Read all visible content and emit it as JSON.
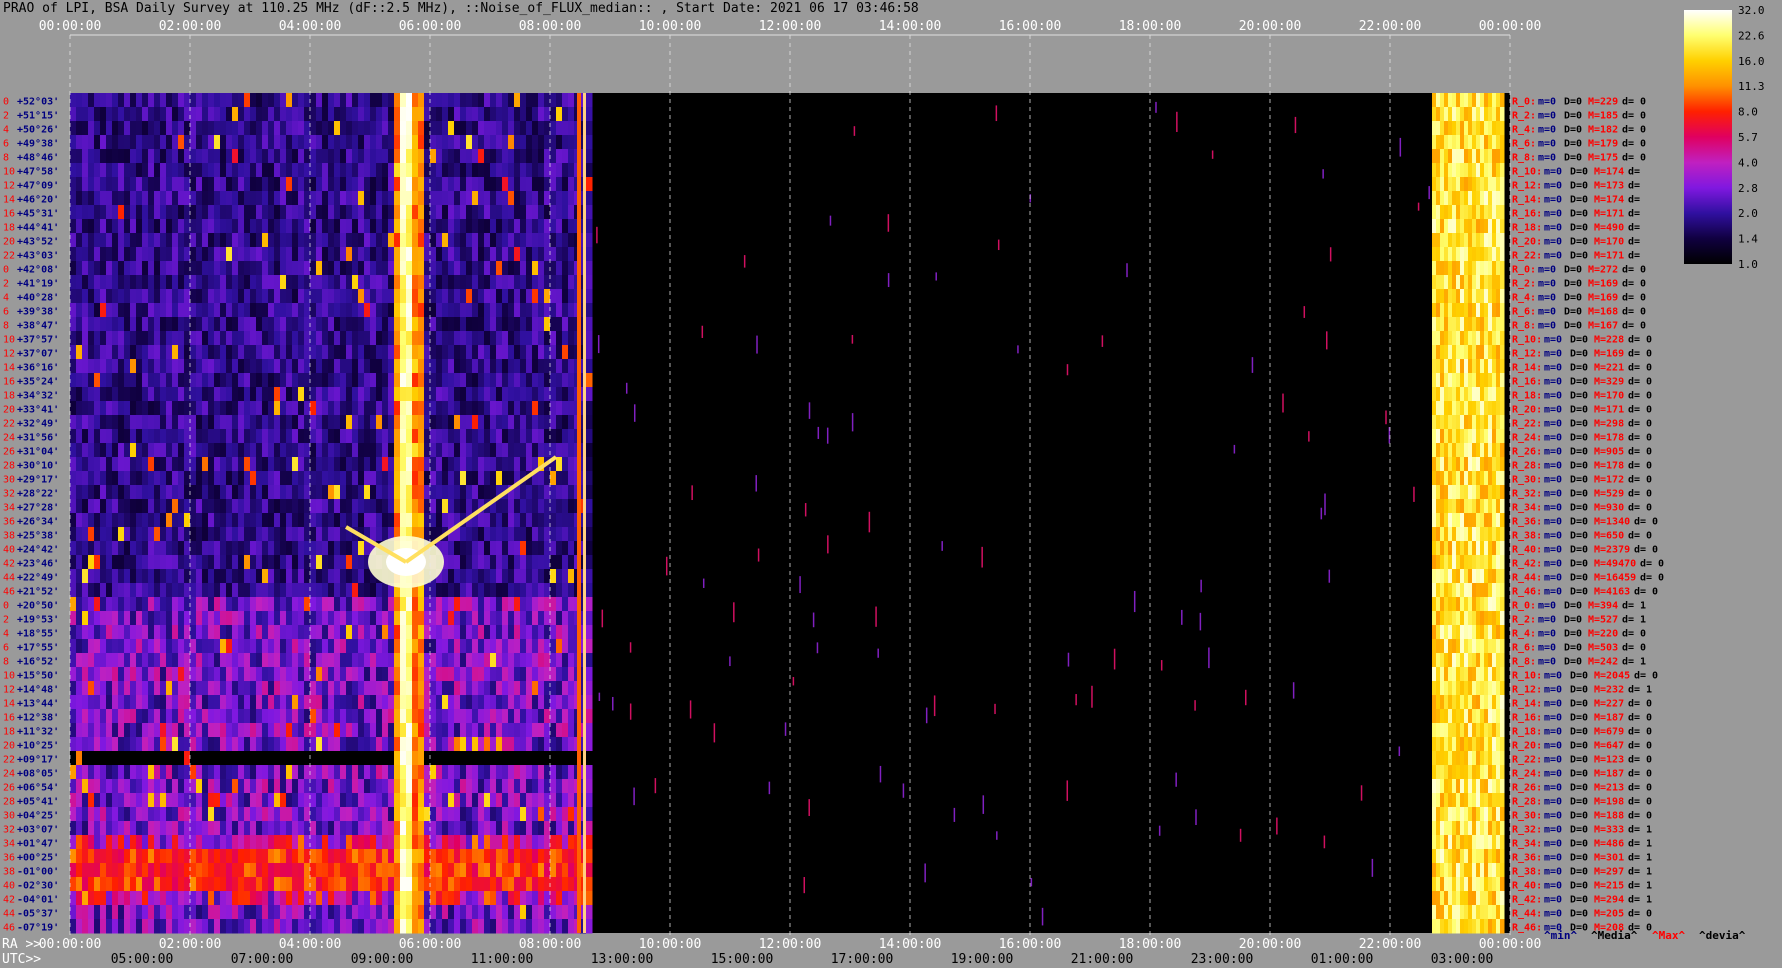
{
  "title": "PRAO of LPI, BSA Daily Survey at 110.25 MHz (dF::2.5 MHz), ::Noise_of_FLUX_median:: , Start Date: 2021 06 17 03:46:58",
  "chart_data": {
    "type": "heatmap",
    "top_ticks": [
      "00:00:00",
      "02:00:00",
      "04:00:00",
      "06:00:00",
      "08:00:00",
      "10:00:00",
      "12:00:00",
      "14:00:00",
      "16:00:00",
      "18:00:00",
      "20:00:00",
      "22:00:00",
      "00:00:00"
    ],
    "ra_prefix": "RA >>",
    "ra_ticks": [
      "00:00:00",
      "02:00:00",
      "04:00:00",
      "06:00:00",
      "08:00:00",
      "10:00:00",
      "12:00:00",
      "14:00:00",
      "16:00:00",
      "18:00:00",
      "20:00:00",
      "22:00:00",
      "00:00:00"
    ],
    "utc_prefix": "UTC>>",
    "utc_ticks": [
      "05:00:00",
      "07:00:00",
      "09:00:00",
      "11:00:00",
      "13:00:00",
      "15:00:00",
      "17:00:00",
      "19:00:00",
      "21:00:00",
      "23:00:00",
      "01:00:00",
      "03:00:00"
    ],
    "rows": [
      {
        "beam": "0",
        "dec": "+52°03'",
        "label": "R_0:",
        "min": "m=0",
        "med": "D=0",
        "max": "M=229",
        "dev": "d= 0"
      },
      {
        "beam": "2",
        "dec": "+51°15'",
        "label": "R_2:",
        "min": "m=0",
        "med": "D=0",
        "max": "M=185",
        "dev": "d= 0"
      },
      {
        "beam": "4",
        "dec": "+50°26'",
        "label": "R_4:",
        "min": "m=0",
        "med": "D=0",
        "max": "M=182",
        "dev": "d= 0"
      },
      {
        "beam": "6",
        "dec": "+49°38'",
        "label": "R_6:",
        "min": "m=0",
        "med": "D=0",
        "max": "M=179",
        "dev": "d= 0"
      },
      {
        "beam": "8",
        "dec": "+48°46'",
        "label": "R_8:",
        "min": "m=0",
        "med": "D=0",
        "max": "M=175",
        "dev": "d= 0"
      },
      {
        "beam": "10",
        "dec": "+47°58'",
        "label": "R_10:",
        "min": "m=0",
        "med": "D=0",
        "max": "M=174",
        "dev": "d="
      },
      {
        "beam": "12",
        "dec": "+47°09'",
        "label": "R_12:",
        "min": "m=0",
        "med": "D=0",
        "max": "M=173",
        "dev": "d="
      },
      {
        "beam": "14",
        "dec": "+46°20'",
        "label": "R_14:",
        "min": "m=0",
        "med": "D=0",
        "max": "M=174",
        "dev": "d="
      },
      {
        "beam": "16",
        "dec": "+45°31'",
        "label": "R_16:",
        "min": "m=0",
        "med": "D=0",
        "max": "M=171",
        "dev": "d="
      },
      {
        "beam": "18",
        "dec": "+44°41'",
        "label": "R_18:",
        "min": "m=0",
        "med": "D=0",
        "max": "M=490",
        "dev": "d="
      },
      {
        "beam": "20",
        "dec": "+43°52'",
        "label": "R_20:",
        "min": "m=0",
        "med": "D=0",
        "max": "M=170",
        "dev": "d="
      },
      {
        "beam": "22",
        "dec": "+43°03'",
        "label": "R_22:",
        "min": "m=0",
        "med": "D=0",
        "max": "M=171",
        "dev": "d="
      },
      {
        "beam": "0",
        "dec": "+42°08'",
        "label": "R_0:",
        "min": "m=0",
        "med": "D=0",
        "max": "M=272",
        "dev": "d= 0"
      },
      {
        "beam": "2",
        "dec": "+41°19'",
        "label": "R_2:",
        "min": "m=0",
        "med": "D=0",
        "max": "M=169",
        "dev": "d= 0"
      },
      {
        "beam": "4",
        "dec": "+40°28'",
        "label": "R_4:",
        "min": "m=0",
        "med": "D=0",
        "max": "M=169",
        "dev": "d= 0"
      },
      {
        "beam": "6",
        "dec": "+39°38'",
        "label": "R_6:",
        "min": "m=0",
        "med": "D=0",
        "max": "M=168",
        "dev": "d= 0"
      },
      {
        "beam": "8",
        "dec": "+38°47'",
        "label": "R_8:",
        "min": "m=0",
        "med": "D=0",
        "max": "M=167",
        "dev": "d= 0"
      },
      {
        "beam": "10",
        "dec": "+37°57'",
        "label": "R_10:",
        "min": "m=0",
        "med": "D=0",
        "max": "M=228",
        "dev": "d= 0"
      },
      {
        "beam": "12",
        "dec": "+37°07'",
        "label": "R_12:",
        "min": "m=0",
        "med": "D=0",
        "max": "M=169",
        "dev": "d= 0"
      },
      {
        "beam": "14",
        "dec": "+36°16'",
        "label": "R_14:",
        "min": "m=0",
        "med": "D=0",
        "max": "M=221",
        "dev": "d= 0"
      },
      {
        "beam": "16",
        "dec": "+35°24'",
        "label": "R_16:",
        "min": "m=0",
        "med": "D=0",
        "max": "M=329",
        "dev": "d= 0"
      },
      {
        "beam": "18",
        "dec": "+34°32'",
        "label": "R_18:",
        "min": "m=0",
        "med": "D=0",
        "max": "M=170",
        "dev": "d= 0"
      },
      {
        "beam": "20",
        "dec": "+33°41'",
        "label": "R_20:",
        "min": "m=0",
        "med": "D=0",
        "max": "M=171",
        "dev": "d= 0"
      },
      {
        "beam": "22",
        "dec": "+32°49'",
        "label": "R_22:",
        "min": "m=0",
        "med": "D=0",
        "max": "M=298",
        "dev": "d= 0"
      },
      {
        "beam": "24",
        "dec": "+31°56'",
        "label": "R_24:",
        "min": "m=0",
        "med": "D=0",
        "max": "M=178",
        "dev": "d= 0"
      },
      {
        "beam": "26",
        "dec": "+31°04'",
        "label": "R_26:",
        "min": "m=0",
        "med": "D=0",
        "max": "M=905",
        "dev": "d= 0"
      },
      {
        "beam": "28",
        "dec": "+30°10'",
        "label": "R_28:",
        "min": "m=0",
        "med": "D=0",
        "max": "M=178",
        "dev": "d= 0"
      },
      {
        "beam": "30",
        "dec": "+29°17'",
        "label": "R_30:",
        "min": "m=0",
        "med": "D=0",
        "max": "M=172",
        "dev": "d= 0"
      },
      {
        "beam": "32",
        "dec": "+28°22'",
        "label": "R_32:",
        "min": "m=0",
        "med": "D=0",
        "max": "M=529",
        "dev": "d= 0"
      },
      {
        "beam": "34",
        "dec": "+27°28'",
        "label": "R_34:",
        "min": "m=0",
        "med": "D=0",
        "max": "M=930",
        "dev": "d= 0"
      },
      {
        "beam": "36",
        "dec": "+26°34'",
        "label": "R_36:",
        "min": "m=0",
        "med": "D=0",
        "max": "M=1340",
        "dev": "d= 0"
      },
      {
        "beam": "38",
        "dec": "+25°38'",
        "label": "R_38:",
        "min": "m=0",
        "med": "D=0",
        "max": "M=650",
        "dev": "d= 0"
      },
      {
        "beam": "40",
        "dec": "+24°42'",
        "label": "R_40:",
        "min": "m=0",
        "med": "D=0",
        "max": "M=2379",
        "dev": "d= 0"
      },
      {
        "beam": "42",
        "dec": "+23°46'",
        "label": "R_42:",
        "min": "m=0",
        "med": "D=0",
        "max": "M=49470",
        "dev": "d= 0"
      },
      {
        "beam": "44",
        "dec": "+22°49'",
        "label": "R_44:",
        "min": "m=0",
        "med": "D=0",
        "max": "M=16459",
        "dev": "d= 0"
      },
      {
        "beam": "46",
        "dec": "+21°52'",
        "label": "R_46:",
        "min": "m=0",
        "med": "D=0",
        "max": "M=4163",
        "dev": "d= 0"
      },
      {
        "beam": "0",
        "dec": "+20°50'",
        "label": "R_0:",
        "min": "m=0",
        "med": "D=0",
        "max": "M=394",
        "dev": "d= 1"
      },
      {
        "beam": "2",
        "dec": "+19°53'",
        "label": "R_2:",
        "min": "m=0",
        "med": "D=0",
        "max": "M=527",
        "dev": "d= 1"
      },
      {
        "beam": "4",
        "dec": "+18°55'",
        "label": "R_4:",
        "min": "m=0",
        "med": "D=0",
        "max": "M=220",
        "dev": "d= 0"
      },
      {
        "beam": "6",
        "dec": "+17°55'",
        "label": "R_6:",
        "min": "m=0",
        "med": "D=0",
        "max": "M=503",
        "dev": "d= 0"
      },
      {
        "beam": "8",
        "dec": "+16°52'",
        "label": "R_8:",
        "min": "m=0",
        "med": "D=0",
        "max": "M=242",
        "dev": "d= 1"
      },
      {
        "beam": "10",
        "dec": "+15°50'",
        "label": "R_10:",
        "min": "m=0",
        "med": "D=0",
        "max": "M=2045",
        "dev": "d= 0"
      },
      {
        "beam": "12",
        "dec": "+14°48'",
        "label": "R_12:",
        "min": "m=0",
        "med": "D=0",
        "max": "M=232",
        "dev": "d= 1"
      },
      {
        "beam": "14",
        "dec": "+13°44'",
        "label": "R_14:",
        "min": "m=0",
        "med": "D=0",
        "max": "M=227",
        "dev": "d= 0"
      },
      {
        "beam": "16",
        "dec": "+12°38'",
        "label": "R_16:",
        "min": "m=0",
        "med": "D=0",
        "max": "M=187",
        "dev": "d= 0"
      },
      {
        "beam": "18",
        "dec": "+11°32'",
        "label": "R_18:",
        "min": "m=0",
        "med": "D=0",
        "max": "M=679",
        "dev": "d= 0"
      },
      {
        "beam": "20",
        "dec": "+10°25'",
        "label": "R_20:",
        "min": "m=0",
        "med": "D=0",
        "max": "M=647",
        "dev": "d= 0"
      },
      {
        "beam": "22",
        "dec": "+09°17'",
        "label": "R_22:",
        "min": "m=0",
        "med": "D=0",
        "max": "M=123",
        "dev": "d= 0"
      },
      {
        "beam": "24",
        "dec": "+08°05'",
        "label": "R_24:",
        "min": "m=0",
        "med": "D=0",
        "max": "M=187",
        "dev": "d= 0"
      },
      {
        "beam": "26",
        "dec": "+06°54'",
        "label": "R_26:",
        "min": "m=0",
        "med": "D=0",
        "max": "M=213",
        "dev": "d= 0"
      },
      {
        "beam": "28",
        "dec": "+05°41'",
        "label": "R_28:",
        "min": "m=0",
        "med": "D=0",
        "max": "M=198",
        "dev": "d= 0"
      },
      {
        "beam": "30",
        "dec": "+04°25'",
        "label": "R_30:",
        "min": "m=0",
        "med": "D=0",
        "max": "M=188",
        "dev": "d= 0"
      },
      {
        "beam": "32",
        "dec": "+03°07'",
        "label": "R_32:",
        "min": "m=0",
        "med": "D=0",
        "max": "M=333",
        "dev": "d= 1"
      },
      {
        "beam": "34",
        "dec": "+01°47'",
        "label": "R_34:",
        "min": "m=0",
        "med": "D=0",
        "max": "M=486",
        "dev": "d= 1"
      },
      {
        "beam": "36",
        "dec": "+00°25'",
        "label": "R_36:",
        "min": "m=0",
        "med": "D=0",
        "max": "M=301",
        "dev": "d= 1"
      },
      {
        "beam": "38",
        "dec": "-01°00'",
        "label": "R_38:",
        "min": "m=0",
        "med": "D=0",
        "max": "M=297",
        "dev": "d= 1"
      },
      {
        "beam": "40",
        "dec": "-02°30'",
        "label": "R_40:",
        "min": "m=0",
        "med": "D=0",
        "max": "M=215",
        "dev": "d= 1"
      },
      {
        "beam": "42",
        "dec": "-04°01'",
        "label": "R_42:",
        "min": "m=0",
        "med": "D=0",
        "max": "M=294",
        "dev": "d= 1"
      },
      {
        "beam": "44",
        "dec": "-05°37'",
        "label": "R_44:",
        "min": "m=0",
        "med": "D=0",
        "max": "M=205",
        "dev": "d= 0"
      },
      {
        "beam": "46",
        "dec": "-07°19'",
        "label": "R_46:",
        "min": "m=0",
        "med": "D=0",
        "max": "M=208",
        "dev": "d= 0"
      }
    ],
    "colorbar": {
      "ticks": [
        "32.0",
        "22.6",
        "16.0",
        "11.3",
        "8.0",
        "5.7",
        "4.0",
        "2.8",
        "2.0",
        "1.4",
        "1.0"
      ],
      "scale": "log",
      "colors": [
        "#ffffff",
        "#ffff70",
        "#ffd000",
        "#ff9000",
        "#ff2000",
        "#e00060",
        "#c020c0",
        "#8018e0",
        "#3010a0",
        "#100040",
        "#000000"
      ]
    },
    "legend": [
      "^min^",
      "^Media^",
      "^Max^",
      "^devia^"
    ],
    "legend_colors": [
      "#000080",
      "#000000",
      "#ff0000",
      "#000000"
    ],
    "sources": [
      {
        "name": "bright source track",
        "ra_hours": 5.6,
        "dec": "+23°46'"
      }
    ]
  }
}
